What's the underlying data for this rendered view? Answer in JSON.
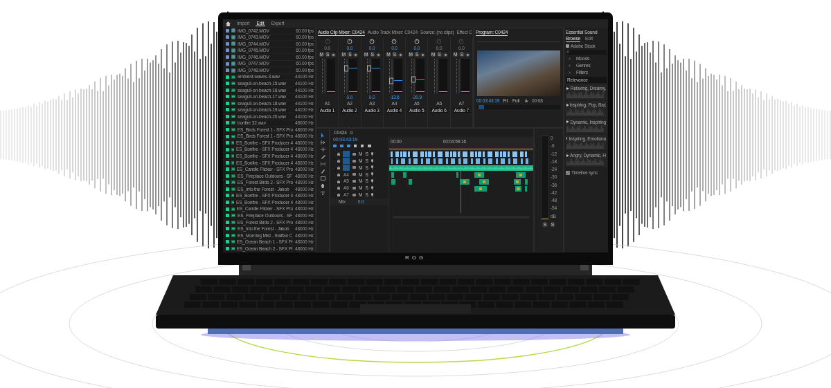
{
  "nav_tabs": [
    {
      "label": "Import",
      "selected": false
    },
    {
      "label": "Edit",
      "selected": true
    },
    {
      "label": "Export",
      "selected": false
    }
  ],
  "media": [
    {
      "kind": "video",
      "name": "IMG_0742.MOV",
      "info": "60.00 fps"
    },
    {
      "kind": "video",
      "name": "IMG_0743.MOV",
      "info": "60.00 fps"
    },
    {
      "kind": "video",
      "name": "IMG_0744.MOV",
      "info": "60.00 fps"
    },
    {
      "kind": "video",
      "name": "IMG_0745.MOV",
      "info": "60.00 fps"
    },
    {
      "kind": "video",
      "name": "IMG_0746.MOV",
      "info": "60.00 fps"
    },
    {
      "kind": "video",
      "name": "IMG_0747.MOV",
      "info": "60.00 fps"
    },
    {
      "kind": "video",
      "name": "IMG_0748.MOV",
      "info": "60.00 fps"
    },
    {
      "kind": "audio",
      "name": "ambient-waves-3.wav",
      "info": "44100 Hz"
    },
    {
      "kind": "audio",
      "name": "seagull-on-beach-15.wav",
      "info": "44100 Hz"
    },
    {
      "kind": "audio",
      "name": "seagull-on-beach-16.wav",
      "info": "44100 Hz"
    },
    {
      "kind": "audio",
      "name": "seagull-on-beach-17.wav",
      "info": "44100 Hz"
    },
    {
      "kind": "audio",
      "name": "seagull-on-beach-18.wav",
      "info": "44100 Hz"
    },
    {
      "kind": "audio",
      "name": "seagull-on-beach-19.wav",
      "info": "44100 Hz"
    },
    {
      "kind": "audio",
      "name": "seagull-on-beach-20.wav",
      "info": "44100 Hz"
    },
    {
      "kind": "audio",
      "name": "bonfire 32.wav",
      "info": "48000 Hz"
    },
    {
      "kind": "audio",
      "name": "ES_Birds Forest 1 - SFX Pro",
      "info": "48000 Hz"
    },
    {
      "kind": "audio",
      "name": "ES_Birds Forest 1 - SFX Pro",
      "info": "48000 Hz"
    },
    {
      "kind": "audio",
      "name": "ES_Bonfire - SFX Producer 4",
      "info": "48000 Hz"
    },
    {
      "kind": "audio",
      "name": "ES_Bonfire - SFX Producer 4",
      "info": "48000 Hz"
    },
    {
      "kind": "audio",
      "name": "ES_Bonfire - SFX Producer 4",
      "info": "48000 Hz"
    },
    {
      "kind": "audio",
      "name": "ES_Bonfire - SFX Producer 4",
      "info": "48000 Hz"
    },
    {
      "kind": "audio",
      "name": "ES_Candle Flicker - SFX Pro",
      "info": "48000 Hz"
    },
    {
      "kind": "audio",
      "name": "ES_Fireplace Outdoors - SF",
      "info": "48000 Hz"
    },
    {
      "kind": "audio",
      "name": "ES_Forest Birds 2 - SFX Pro",
      "info": "48000 Hz"
    },
    {
      "kind": "audio",
      "name": "ES_Into the Forest - Jakob",
      "info": "48000 Hz"
    },
    {
      "kind": "audio",
      "name": "ES_Bonfire - SFX Producer 4",
      "info": "48000 Hz"
    },
    {
      "kind": "audio",
      "name": "ES_Bonfire - SFX Producer 4",
      "info": "48000 Hz"
    },
    {
      "kind": "audio",
      "name": "ES_Candle Flicker - SFX Pro",
      "info": "48000 Hz"
    },
    {
      "kind": "audio",
      "name": "ES_Fireplace Outdoors - SF",
      "info": "48000 Hz"
    },
    {
      "kind": "audio",
      "name": "ES_Forest Birds 2 - SFX Pro",
      "info": "48000 Hz"
    },
    {
      "kind": "audio",
      "name": "ES_Into the Forest - Jakob",
      "info": "48000 Hz"
    },
    {
      "kind": "audio",
      "name": "ES_Morning Mist - Staffan C",
      "info": "48000 Hz"
    },
    {
      "kind": "audio",
      "name": "ES_Ocean Beach 1 - SFX Pr",
      "info": "48000 Hz"
    },
    {
      "kind": "audio",
      "name": "ES_Ocean Beach 2 - SFX Pr",
      "info": "48000 Hz"
    }
  ],
  "mixer": {
    "tabs": [
      {
        "label": "Audio Clip Mixer: C0424",
        "selected": true
      },
      {
        "label": "Audio Track Mixer: C0424",
        "selected": false
      },
      {
        "label": "Source: (no clips)",
        "selected": false
      },
      {
        "label": "Effect C",
        "selected": false
      }
    ],
    "channels": [
      {
        "track": "A1",
        "name": "Audio 1",
        "active": false,
        "pan": "0.0",
        "buttons": [
          "M",
          "S"
        ]
      },
      {
        "track": "A2",
        "name": "Audio 2",
        "active": true,
        "pan": "0.0",
        "buttons": [
          "M",
          "S"
        ],
        "level": 0.73,
        "reading": "0.0"
      },
      {
        "track": "A3",
        "name": "Audio 3",
        "active": true,
        "pan": "0.0",
        "buttons": [
          "M",
          "S"
        ],
        "level": 0.73,
        "reading": "0.0"
      },
      {
        "track": "A4",
        "name": "Audio 4",
        "active": true,
        "pan": "0.0",
        "buttons": [
          "M",
          "S"
        ],
        "level": 0.37,
        "reading": "-13.6"
      },
      {
        "track": "A5",
        "name": "Audio 5",
        "active": true,
        "pan": "0.0",
        "buttons": [
          "M",
          "S"
        ],
        "level": 0.4,
        "reading": "-20.9"
      },
      {
        "track": "A6",
        "name": "Audio 6",
        "active": false,
        "pan": "0.0",
        "buttons": [
          "M",
          "S"
        ]
      },
      {
        "track": "A7",
        "name": "Audio 7",
        "active": false,
        "pan": "0.0",
        "buttons": [
          "M",
          "S"
        ]
      }
    ]
  },
  "program": {
    "title": "Program: C0424",
    "timecode": "00:03:43:19",
    "zoom": "Fit",
    "quality": "Full",
    "duration": "00:08"
  },
  "type_tool": "T",
  "timeline": {
    "title": "C0424",
    "timecode": "00:03:43:19",
    "ruler": [
      "00:00",
      "00:04:59:16"
    ],
    "tracks": [
      {
        "targeted": true,
        "buttons": [
          "M",
          "S"
        ]
      },
      {
        "targeted": true,
        "buttons": [
          "M",
          "S"
        ]
      },
      {
        "targeted": true,
        "buttons": [
          "M",
          "S"
        ]
      },
      {
        "label": "A4",
        "targeted": false,
        "buttons": [
          "M",
          "S"
        ]
      },
      {
        "label": "A5",
        "targeted": false,
        "buttons": [
          "M",
          "S"
        ]
      },
      {
        "label": "A6",
        "targeted": false,
        "buttons": [
          "M",
          "S"
        ]
      },
      {
        "label": "A7",
        "targeted": false,
        "buttons": [
          "M",
          "S"
        ]
      }
    ],
    "mix": {
      "label": "Mix",
      "value": "0.0"
    }
  },
  "meter": {
    "scale": [
      "0",
      "-6",
      "-12",
      "-18",
      "-24",
      "-30",
      "-36",
      "-42",
      "-48",
      "-54",
      "dB"
    ],
    "buttons": [
      "S",
      "S"
    ]
  },
  "essential_sound": {
    "title": "Essential Sound",
    "tabs": [
      {
        "label": "Browse",
        "selected": true
      },
      {
        "label": "Edit",
        "selected": false
      }
    ],
    "source": "Adobe Stock",
    "categories": [
      "Moods",
      "Genres",
      "Filters"
    ],
    "sort": "Relevance",
    "results": [
      "Relaxing, Dreamy,",
      "Inspiring, Pop, Bac",
      "Dynamic, Inspiring",
      "Inspiring, Emotiona",
      "Angry, Dynamic, H"
    ],
    "timeline_sync": {
      "label": "Timeline sync",
      "checked": true
    }
  },
  "bezel_logo": "ROG"
}
